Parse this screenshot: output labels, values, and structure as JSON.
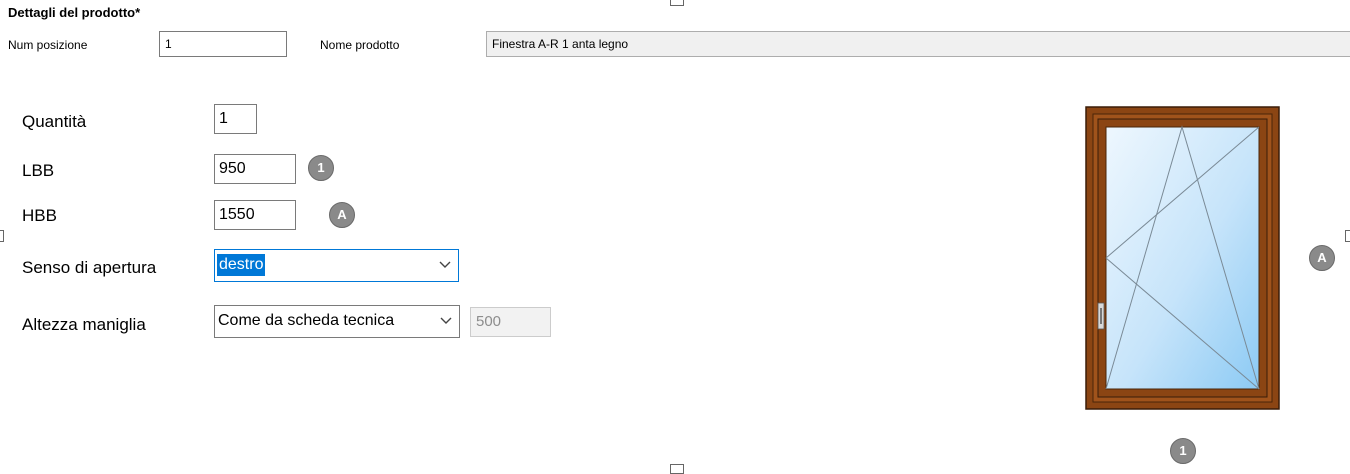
{
  "section": {
    "title": "Dettagli del prodotto*"
  },
  "header": {
    "position_label": "Num posizione",
    "position_value": "1",
    "product_name_label": "Nome prodotto",
    "product_name_value": "Finestra A-R 1 anta legno"
  },
  "form": {
    "quantity_label": "Quantità",
    "quantity_value": "1",
    "lbb_label": "LBB",
    "lbb_value": "950",
    "lbb_badge": "1",
    "hbb_label": "HBB",
    "hbb_value": "1550",
    "hbb_badge": "A",
    "opening_label": "Senso di apertura",
    "opening_value": "destro",
    "handle_label": "Altezza maniglia",
    "handle_mode_value": "Come da scheda tecnica",
    "handle_height_value": "500"
  },
  "preview": {
    "height_badge": "A",
    "width_badge": "1"
  },
  "colors": {
    "frame": "#8b4513",
    "glass_light": "#e8f4fd",
    "glass_dark": "#9fd1f5",
    "badge": "#8a8a8a",
    "focus": "#0078d7"
  },
  "icons": {
    "dropdown": "chevron-down-icon"
  }
}
